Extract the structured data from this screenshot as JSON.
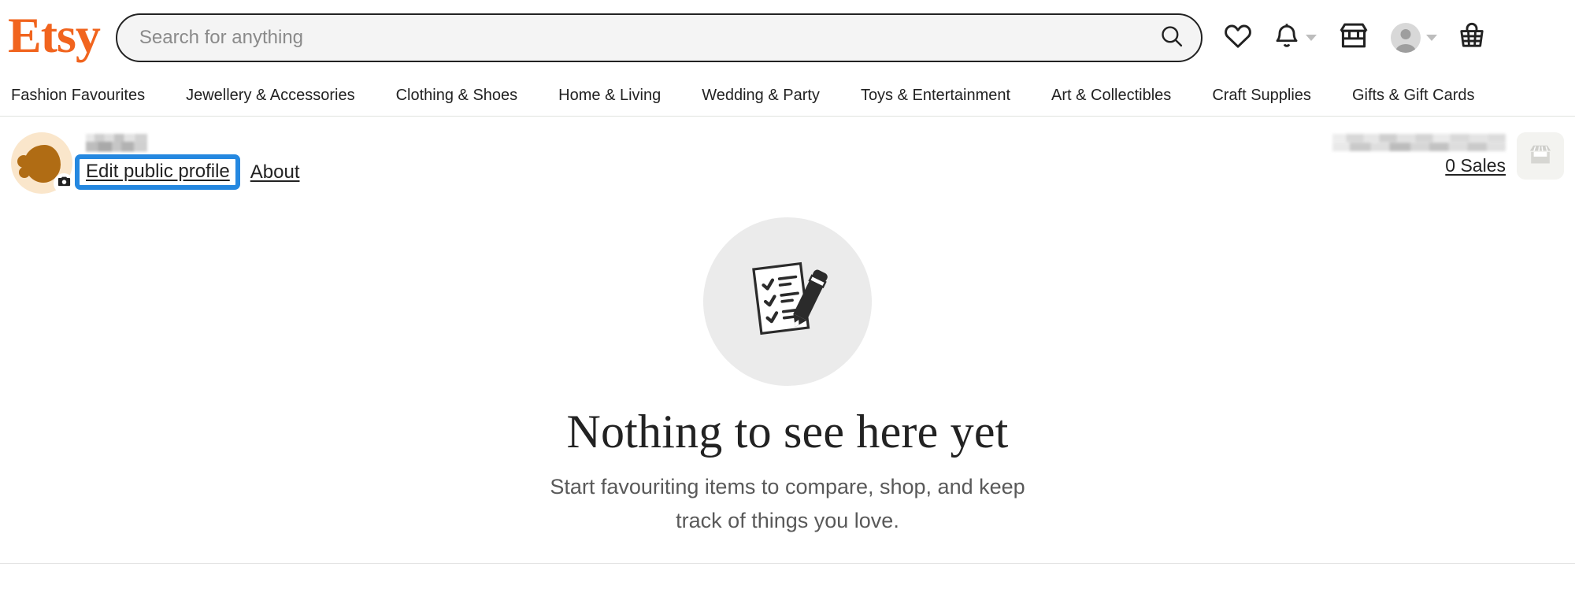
{
  "brand": {
    "logo_text": "Etsy",
    "logo_color": "#F1641E"
  },
  "search": {
    "placeholder": "Search for anything",
    "value": "",
    "icon": "search-icon"
  },
  "header_icons": [
    {
      "name": "favourites-icon",
      "label": "Favourites",
      "has_caret": false
    },
    {
      "name": "notifications-icon",
      "label": "Notifications",
      "has_caret": true
    },
    {
      "name": "shop-manager-icon",
      "label": "Shop Manager",
      "has_caret": false
    },
    {
      "name": "account-avatar-icon",
      "label": "Your account",
      "has_caret": true
    },
    {
      "name": "cart-basket-icon",
      "label": "Cart",
      "has_caret": false
    }
  ],
  "category_nav": [
    {
      "label": "Fashion Favourites"
    },
    {
      "label": "Jewellery & Accessories"
    },
    {
      "label": "Clothing & Shoes"
    },
    {
      "label": "Home & Living"
    },
    {
      "label": "Wedding & Party"
    },
    {
      "label": "Toys & Entertainment"
    },
    {
      "label": "Art & Collectibles"
    },
    {
      "label": "Craft Supplies"
    },
    {
      "label": "Gifts & Gift Cards"
    }
  ],
  "profile": {
    "avatar_icon": "user-avatar-photo",
    "avatar_bg": "#FAE6CB",
    "avatar_shape_color": "#B06C14",
    "camera_badge_icon": "camera-icon",
    "username_redacted": true,
    "edit_link": "Edit public profile",
    "about_link": "About",
    "focus_color": "#2588E0"
  },
  "shop": {
    "name_redacted": true,
    "sales_label": "0 Sales",
    "tile_icon": "storefront-icon"
  },
  "empty_state": {
    "illustration": "checklist-pencil-icon",
    "title": "Nothing to see here yet",
    "subtitle": "Start favouriting items to compare, shop, and keep track of things you love."
  }
}
